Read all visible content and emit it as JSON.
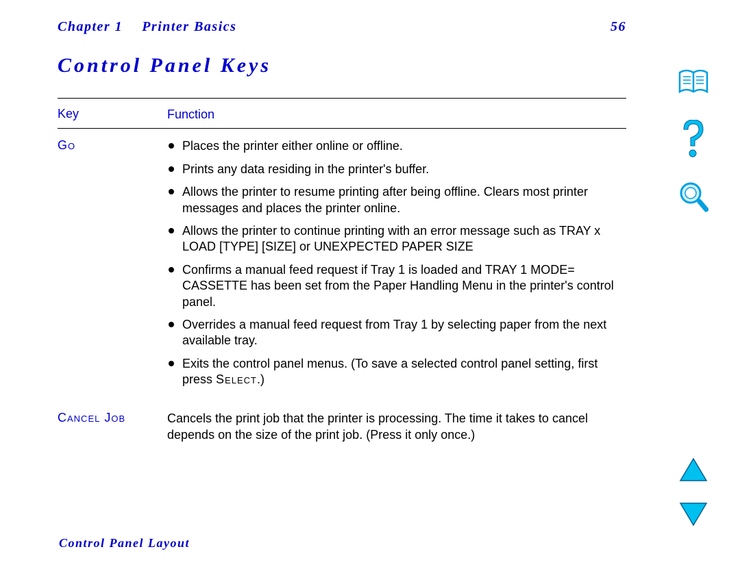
{
  "header": {
    "chapter_label": "Chapter 1",
    "chapter_title": "Printer Basics",
    "page_number": "56"
  },
  "title": "Control Panel Keys",
  "table": {
    "headers": {
      "key": "Key",
      "function": "Function"
    },
    "rows": [
      {
        "key_name": "Go",
        "bullets": [
          "Places the printer either online or offline.",
          "Prints any data residing in the printer's buffer.",
          "Allows the printer to resume printing after being offline. Clears most printer messages and places the printer online.",
          {
            "pre": "Allows the printer to continue printing with an error message such as ",
            "code": "TRAY x LOAD [TYPE] [SIZE]",
            "mid": " or ",
            "code2": "UNEXPECTED PAPER SIZE"
          },
          {
            "pre": "Confirms a manual feed request if Tray 1 is loaded and ",
            "code": "TRAY 1 MODE= CASSETTE",
            "post": " has been set from the Paper Handling Menu in the printer's control panel."
          },
          "Overrides a manual feed request from Tray 1 by selecting paper from the next available tray.",
          {
            "pre": "Exits the control panel menus. (To save a selected control panel setting, first press ",
            "sc": "Select",
            "post": ".)"
          }
        ]
      },
      {
        "key_name": "Cancel Job",
        "text": "Cancels the print job that the printer is processing. The time it takes to cancel depends on the size of the print job. (Press it only once.)"
      }
    ]
  },
  "footer_link": "Control Panel Layout",
  "icons": {
    "book": "book-icon",
    "help": "help-icon",
    "search": "search-icon",
    "up": "up-arrow",
    "down": "down-arrow"
  }
}
